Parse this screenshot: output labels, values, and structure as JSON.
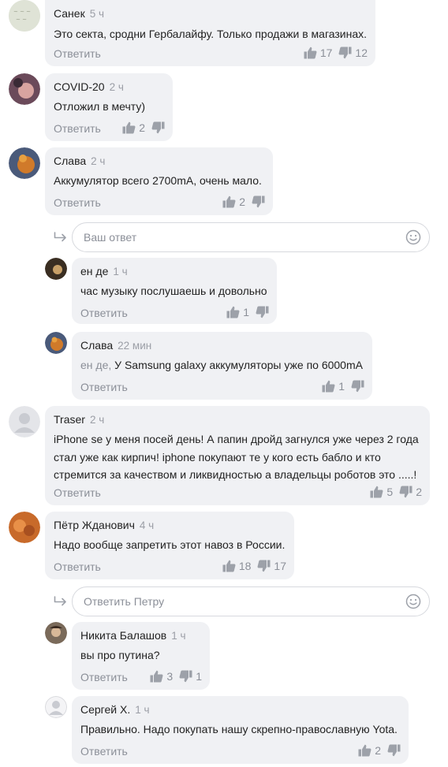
{
  "reply_label": "Ответить",
  "comments": [
    {
      "author": "Санек",
      "time": "5 ч",
      "lines": [
        "Это секта, сродни Гербалайфу. Только продажи в магазинах."
      ],
      "likes": "17",
      "dislikes": "12"
    },
    {
      "author": "COVID-20",
      "time": "2 ч",
      "lines": [
        "Отложил в мечту)"
      ],
      "likes": "2",
      "dislikes": ""
    },
    {
      "author": "Слава",
      "time": "2 ч",
      "lines": [
        "Аккумулятор всего 2700mA, очень мало."
      ],
      "likes": "2",
      "dislikes": ""
    },
    {
      "author": "ен де",
      "time": "1 ч",
      "lines": [
        "час музыку послушаешь и довольно"
      ],
      "likes": "1",
      "dislikes": ""
    },
    {
      "author": "Слава",
      "time": "22 мин",
      "mention": "ен де,",
      "lines": [
        "У Samsung galaxy аккумуляторы уже по 6000mA"
      ],
      "likes": "1",
      "dislikes": ""
    },
    {
      "author": "Traser",
      "time": "2 ч",
      "lines": [
        "iPhone se у меня посей день! А папин дройд загнулся уже через 2 года",
        "стал уже как кирпич! iphone покупают те у кого есть бабло и кто",
        "стремится за качеством и ликвидностью а владельцы роботов это .....!"
      ],
      "likes": "5",
      "dislikes": "2"
    },
    {
      "author": "Пётр Жданович",
      "time": "4 ч",
      "lines": [
        "Надо вообще запретить этот навоз в России."
      ],
      "likes": "18",
      "dislikes": "17"
    },
    {
      "author": "Никита Балашов",
      "time": "1 ч",
      "lines": [
        "вы про путина?"
      ],
      "likes": "3",
      "dislikes": "1"
    },
    {
      "author": "Сергей Х.",
      "time": "1 ч",
      "lines": [
        "Правильно. Надо покупать нашу скрепно-православную Yota."
      ],
      "likes": "2",
      "dislikes": ""
    }
  ],
  "reply_boxes": [
    {
      "placeholder": "Ваш ответ"
    },
    {
      "placeholder": "Ответить Петру"
    }
  ],
  "icons": {
    "like": "thumbs-up-icon",
    "dislike": "thumbs-down-icon",
    "reply_arrow": "reply-arrow-icon",
    "emoji": "emoji-icon"
  },
  "colors": {
    "bubble": "#f0f1f4",
    "muted": "#8b8f98",
    "text": "#222222"
  }
}
